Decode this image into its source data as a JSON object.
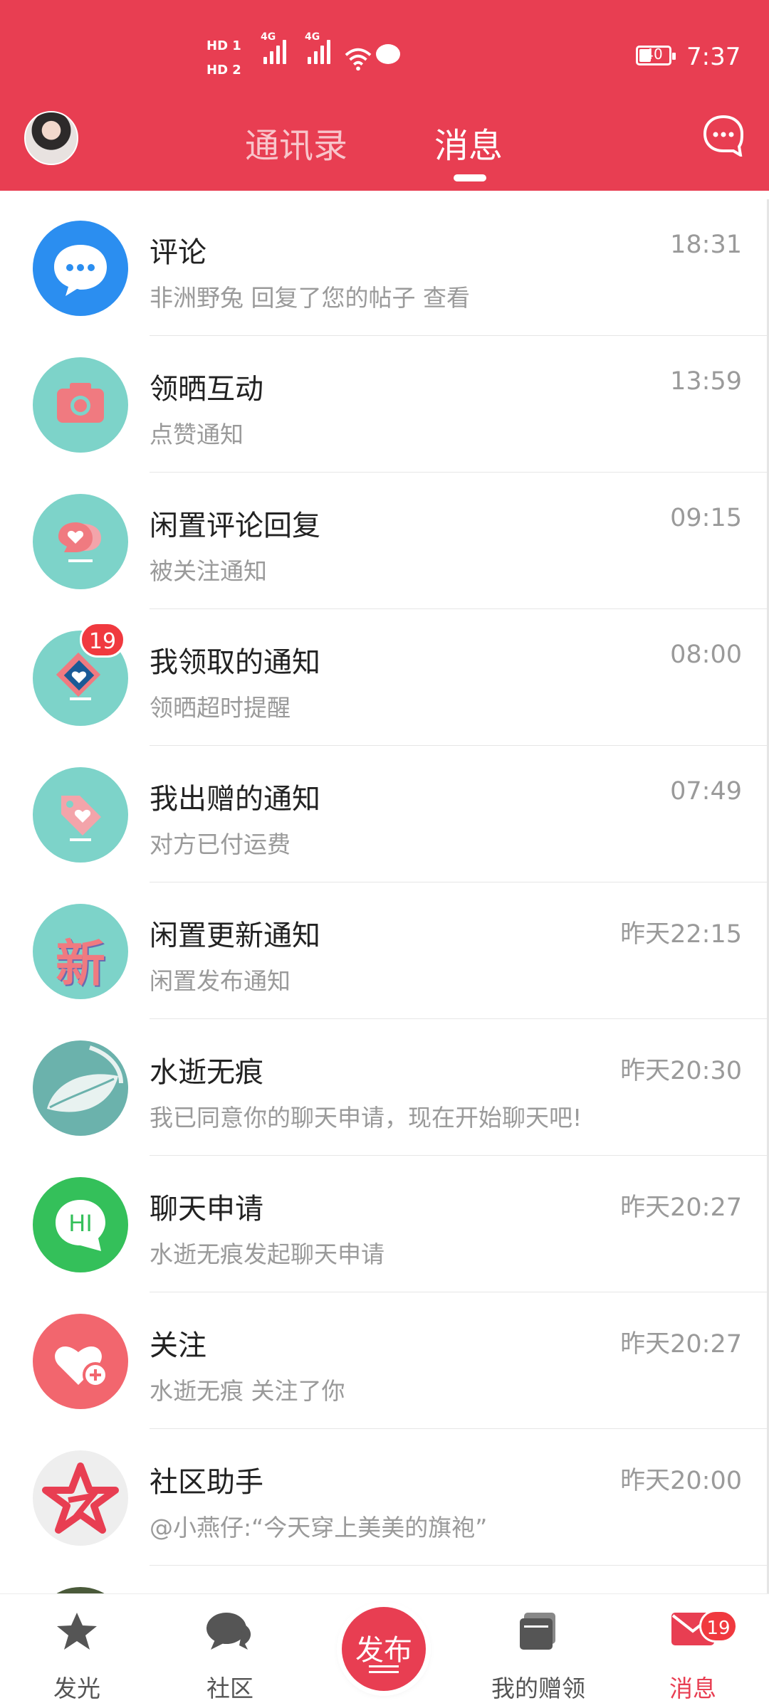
{
  "status_bar": {
    "hd1": "HD 1",
    "hd2": "HD 2",
    "net1": "4G",
    "net2": "4G",
    "battery": "40",
    "time": "7:37"
  },
  "header": {
    "tab_contacts": "通讯录",
    "tab_messages": "消息",
    "active_tab": "消息"
  },
  "messages": [
    {
      "title": "评论",
      "subtitle": "非洲野兔 回复了您的帖子   查看",
      "time": "18:31",
      "icon": "comment-bubble-icon"
    },
    {
      "title": "领晒互动",
      "subtitle": "点赞通知",
      "time": "13:59",
      "icon": "camera-icon"
    },
    {
      "title": "闲置评论回复",
      "subtitle": "被关注通知",
      "time": "09:15",
      "icon": "heart-chat-icon"
    },
    {
      "title": "我领取的通知",
      "subtitle": "领晒超时提醒",
      "time": "08:00",
      "icon": "gift-heart-icon",
      "badge": "19"
    },
    {
      "title": "我出赠的通知",
      "subtitle": "对方已付运费",
      "time": "07:49",
      "icon": "tag-heart-icon"
    },
    {
      "title": "闲置更新通知",
      "subtitle": "闲置发布通知",
      "time": "昨天22:15",
      "icon": "new-icon",
      "icon_text": "新"
    },
    {
      "title": "水逝无痕",
      "subtitle": "我已同意你的聊天申请，现在开始聊天吧!",
      "time": "昨天20:30",
      "icon": "leaf-avatar"
    },
    {
      "title": "聊天申请",
      "subtitle": "水逝无痕发起聊天申请",
      "time": "昨天20:27",
      "icon": "hi-chat-icon",
      "icon_text": "HI"
    },
    {
      "title": "关注",
      "subtitle": "水逝无痕 关注了你",
      "time": "昨天20:27",
      "icon": "heart-plus-icon"
    },
    {
      "title": "社区助手",
      "subtitle": "@小燕仔:“今天穿上美美的旗袍”",
      "time": "昨天20:00",
      "icon": "star-logo-icon"
    }
  ],
  "bottom_nav": {
    "items": [
      {
        "label": "发光",
        "icon": "star-icon"
      },
      {
        "label": "社区",
        "icon": "chat-icon"
      },
      {
        "label": "发布",
        "icon": "publish-icon"
      },
      {
        "label": "我的赠领",
        "icon": "cards-icon"
      },
      {
        "label": "消息",
        "icon": "mail-icon",
        "badge": "19"
      }
    ],
    "active": "消息"
  },
  "colors": {
    "brand": "#e83e52",
    "badge": "#f0393f",
    "teal": "#7dd3c9",
    "green": "#34c05a",
    "blue": "#2196f3"
  }
}
